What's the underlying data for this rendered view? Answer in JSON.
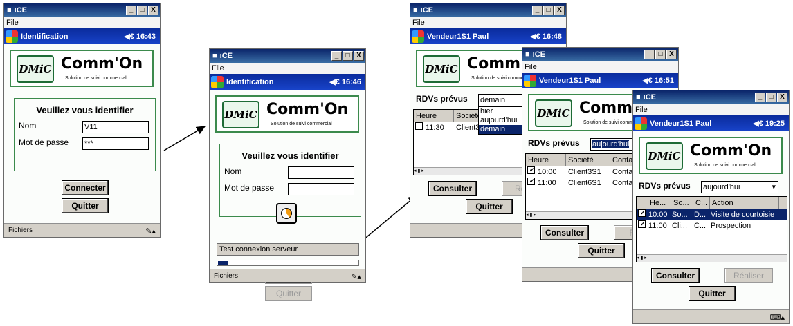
{
  "window": {
    "app": "ıCE",
    "controls": [
      "_",
      "□",
      "X"
    ]
  },
  "menu": {
    "file": "File"
  },
  "footer": {
    "fichiers": "Fichiers"
  },
  "logo": {
    "badge": "DMiC",
    "name": "Comm'On",
    "tagline": "Solution de suivi commercial"
  },
  "login": {
    "nav_title": "Identification",
    "heading": "Veuillez vous identifier",
    "nom_label": "Nom",
    "pwd_label": "Mot de passe",
    "nom_value": "V11",
    "pwd_value": "***",
    "connect": "Connecter",
    "quit": "Quitter"
  },
  "screen1": {
    "clock": "16:43"
  },
  "screen2": {
    "clock": "16:46",
    "status": "Test connexion serveur",
    "progress_percent": 7
  },
  "screen3": {
    "user": "Vendeur1S1 Paul",
    "clock": "16:48",
    "rdv_label": "RDVs prévus",
    "select": "demain",
    "dropdown": [
      "hier",
      "aujourd'hui",
      "demain"
    ],
    "headers": [
      "Heure",
      "Société"
    ],
    "rows": [
      {
        "time": "11:30",
        "client": "Client3"
      }
    ]
  },
  "screen4": {
    "user": "Vendeur1S1 Paul",
    "clock": "16:51",
    "rdv_label": "RDVs prévus",
    "select": "aujourd'hui",
    "headers": [
      "Heure",
      "Société",
      "Conta"
    ],
    "rows": [
      {
        "time": "10:00",
        "client": "Client3S1",
        "contact": "Conta"
      },
      {
        "time": "11:00",
        "client": "Client6S1",
        "contact": "Conta"
      }
    ]
  },
  "screen5": {
    "user": "Vendeur1S1 Paul",
    "clock": "19:25",
    "rdv_label": "RDVs prévus",
    "select": "aujourd'hui",
    "headers": [
      "He...",
      "So...",
      "C...",
      "Action"
    ],
    "rows": [
      {
        "time": "10:00",
        "client": "So...",
        "contact": "D...",
        "action": "Visite de courtoisie"
      },
      {
        "time": "11:00",
        "client": "Cli...",
        "contact": "C...",
        "action": "Prospection"
      }
    ]
  },
  "buttons": {
    "consulter": "Consulter",
    "realiser": "Réaliser",
    "realiser_cut": "Réa",
    "realiser_cut2": "Ré",
    "quitter": "Quitter"
  }
}
